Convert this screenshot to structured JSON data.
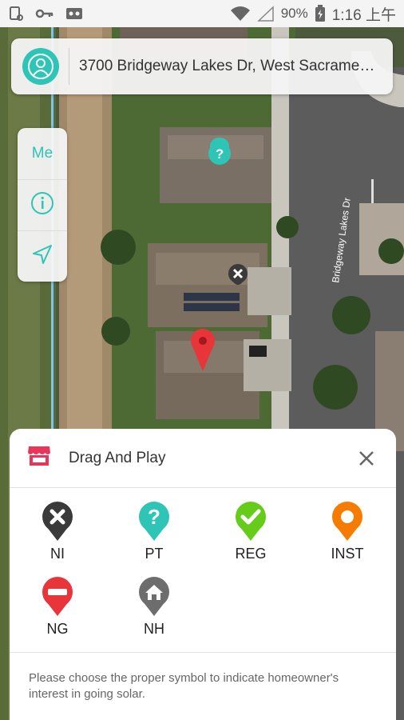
{
  "status": {
    "battery": "90%",
    "time": "1:16 上午"
  },
  "address": {
    "text": "3700 Bridgeway Lakes Dr, West Sacrame…"
  },
  "map": {
    "street_label": "Bridgeway Lakes Dr"
  },
  "side_controls": {
    "me_label": "Me"
  },
  "sheet": {
    "title": "Drag And Play",
    "tools": [
      {
        "label": "NI",
        "color": "#3a3a3a",
        "icon": "x-icon"
      },
      {
        "label": "PT",
        "color": "#2ec4b6",
        "icon": "question-icon"
      },
      {
        "label": "REG",
        "color": "#66cc1a",
        "icon": "check-icon"
      },
      {
        "label": "INST",
        "color": "#f57c00",
        "icon": "ring-icon"
      },
      {
        "label": "NG",
        "color": "#e8353a",
        "icon": "minus-icon"
      },
      {
        "label": "NH",
        "color": "#6d6d6d",
        "icon": "house-icon"
      }
    ],
    "note": "Please choose the proper symbol to indicate homeowner's interest in going solar."
  },
  "colors": {
    "accent": "#2ec4b6",
    "store_icon": "#e8355a",
    "marker_red": "#e8353a"
  }
}
